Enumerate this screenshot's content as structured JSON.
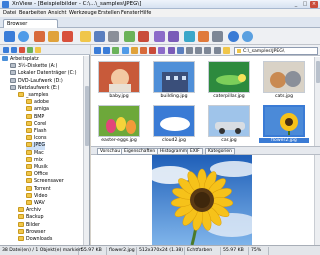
{
  "window": {
    "title": "XnView - [Beispielbilder - C:\\...\\_samples\\JPEG\\]",
    "controls": [
      "_",
      "□",
      "×"
    ]
  },
  "menu": [
    "Datei",
    "Bearbeiten",
    "Ansicht",
    "Werkzeuge",
    "Erstellen",
    "Fenster",
    "Hilfe"
  ],
  "tabs": [
    {
      "label": "Browser"
    }
  ],
  "toolbar": {
    "icons": [
      "home-icon",
      "refresh-icon",
      "back-icon",
      "forward-icon",
      "up-icon",
      "open-icon",
      "save-icon",
      "print-icon",
      "scan-icon",
      "delete-icon",
      "rotate-left-icon",
      "rotate-right-icon",
      "slideshow-icon",
      "convert-icon",
      "settings-icon",
      "info-icon",
      "help-icon"
    ]
  },
  "tree": {
    "header_icons": [
      "back-icon",
      "forward-icon",
      "home-icon",
      "up-icon",
      "folder-icon"
    ],
    "items": [
      {
        "label": "Arbeitsplatz",
        "type": "desk"
      },
      {
        "label": "3½-Diskette (A:)",
        "type": "drive"
      },
      {
        "label": "Lokaler Datenträger (C:)",
        "type": "drive"
      },
      {
        "label": "DVD-Laufwerk (D:)",
        "type": "drive"
      },
      {
        "label": "Netzlaufwerk (E:)",
        "type": "drive"
      },
      {
        "label": "_samples",
        "type": "folder"
      },
      {
        "label": "adobe",
        "type": "folder"
      },
      {
        "label": "amiga",
        "type": "folder"
      },
      {
        "label": "BMP",
        "type": "folder"
      },
      {
        "label": "Corel",
        "type": "folder"
      },
      {
        "label": "Flash",
        "type": "folder"
      },
      {
        "label": "Icons",
        "type": "folder"
      },
      {
        "label": "JPEG",
        "type": "folder",
        "selected": true
      },
      {
        "label": "Mac",
        "type": "folder"
      },
      {
        "label": "mix",
        "type": "folder"
      },
      {
        "label": "Musik",
        "type": "folder"
      },
      {
        "label": "Office",
        "type": "folder"
      },
      {
        "label": "Screensaver",
        "type": "folder"
      },
      {
        "label": "Torrent",
        "type": "folder"
      },
      {
        "label": "Video",
        "type": "folder"
      },
      {
        "label": "WAV",
        "type": "folder"
      },
      {
        "label": "Archiv",
        "type": "folder"
      },
      {
        "label": "Backup",
        "type": "folder"
      },
      {
        "label": "Bilder",
        "type": "folder"
      },
      {
        "label": "Browser",
        "type": "folder"
      },
      {
        "label": "Downloads",
        "type": "folder"
      }
    ]
  },
  "navbar": {
    "path": "C:\\_samples\\JPEG\\",
    "icons": [
      "back-icon",
      "forward-icon",
      "up-icon",
      "refresh-icon",
      "copy-icon",
      "move-icon",
      "delete-icon",
      "filter-icon",
      "sort-icon",
      "view-icon",
      "grid-icon",
      "list-icon",
      "details-icon",
      "thumbnail-icon",
      "folder-icon"
    ]
  },
  "thumbnails": [
    {
      "label": "baby.jpg",
      "scene": "baby"
    },
    {
      "label": "building.jpg",
      "scene": "building"
    },
    {
      "label": "caterpillar.jpg",
      "scene": "caterpillar"
    },
    {
      "label": "cats.jpg",
      "scene": "cats"
    },
    {
      "label": "easter-eggs.jpg",
      "scene": "eggs"
    },
    {
      "label": "cloud2.jpg",
      "scene": "cloud"
    },
    {
      "label": "car.jpg",
      "scene": "car"
    },
    {
      "label": "flower2.jpg",
      "scene": "flower",
      "selected": true
    }
  ],
  "preview_tabs": [
    {
      "label": "Vorschau",
      "active": true
    },
    {
      "label": "Eigenschaften"
    },
    {
      "label": "Histogramm"
    },
    {
      "label": "EXIF"
    },
    {
      "label": "Kategorien"
    }
  ],
  "status": [
    "38 Datei(en) / 1 Objekt(e) markiert",
    "55.97 KB",
    "flower2.jpg",
    "512x370x24 (1.38)",
    "Echtfarben",
    "55.97 KB",
    "75%"
  ],
  "colors": {
    "accent": "#3a7bd5",
    "folder": "#f0c64a",
    "close": "#c94b3a"
  }
}
